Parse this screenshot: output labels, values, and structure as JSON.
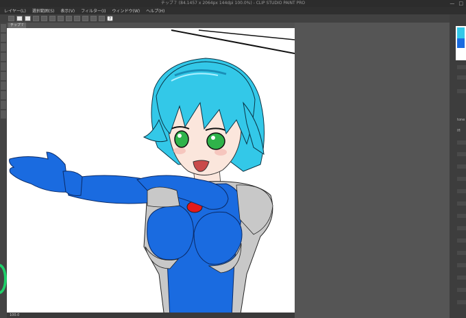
{
  "window": {
    "title": "チップ７ (84.1457 x 2064px 144dpi 100.0%) - CLIP STUDIO PAINT PRO"
  },
  "menu": {
    "items": [
      "レイヤー(L)",
      "選択範囲(S)",
      "表示(V)",
      "フィルター(I)",
      "ウィンドウ(W)",
      "ヘルプ(H)"
    ]
  },
  "toolbar": {
    "help_label": "?"
  },
  "canvas_tab": {
    "label": "チップ７"
  },
  "status": {
    "zoom": "100.0"
  },
  "right_panel": {
    "label_a": "tone",
    "label_b": "Ifl"
  },
  "colors": {
    "hair": "#33c8e8",
    "hair_shadow": "#1a8fb8",
    "suit_blue": "#1a6be0",
    "suit_grey": "#c8c8c8",
    "skin": "#fbe6dc",
    "eyes": "#2fb34a",
    "gem": "#e21a1a"
  }
}
